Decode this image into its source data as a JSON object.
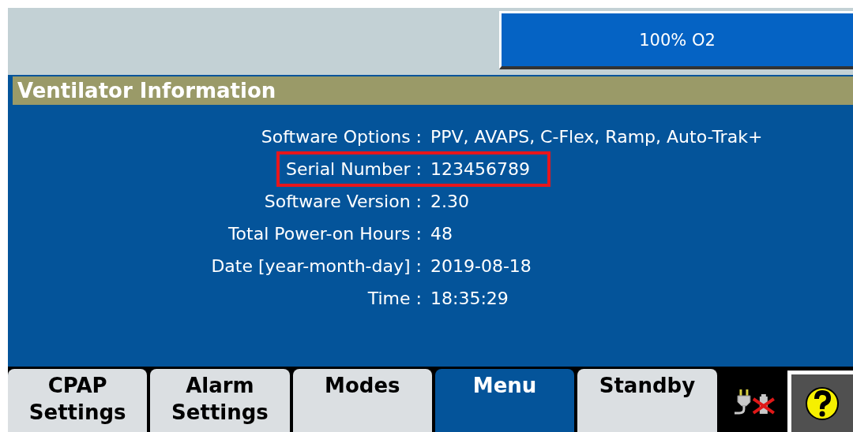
{
  "o2_button": {
    "label": "100% O2"
  },
  "panel": {
    "title": "Ventilator Information"
  },
  "rows": [
    {
      "label": "Software Options :",
      "value": "PPV, AVAPS, C-Flex, Ramp, Auto-Trak+",
      "highlighted": false
    },
    {
      "label": "Serial Number :",
      "value": "123456789",
      "highlighted": true
    },
    {
      "label": "Software Version :",
      "value": "2.30",
      "highlighted": false
    },
    {
      "label": "Total Power-on Hours :",
      "value": "48",
      "highlighted": false
    },
    {
      "label": "Date [year-month-day] :",
      "value": "2019-08-18",
      "highlighted": false
    },
    {
      "label": "Time :",
      "value": "18:35:29",
      "highlighted": false
    }
  ],
  "tabs": [
    {
      "lines": [
        "CPAP",
        "Settings"
      ],
      "selected": false
    },
    {
      "lines": [
        "Alarm",
        "Settings"
      ],
      "selected": false
    },
    {
      "lines": [
        "Modes"
      ],
      "selected": false
    },
    {
      "lines": [
        "Menu"
      ],
      "selected": true
    },
    {
      "lines": [
        "Standby"
      ],
      "selected": false
    }
  ],
  "power": {
    "battery_present": false
  }
}
